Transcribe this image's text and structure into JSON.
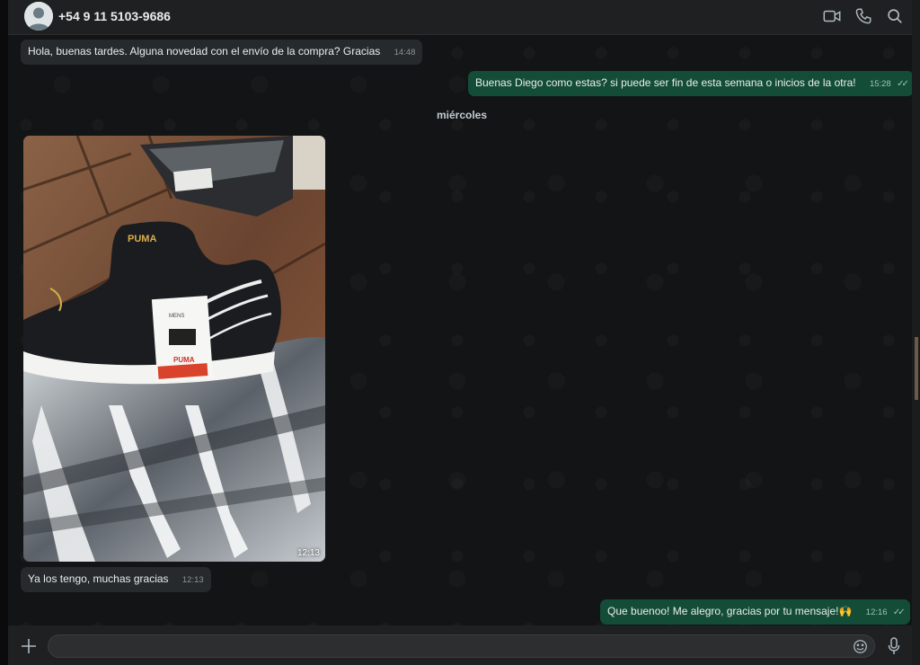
{
  "header": {
    "contact_name": "+54 9 11 5103-9686",
    "icons": [
      "avatar-icon",
      "video-call-icon",
      "voice-call-icon",
      "search-icon"
    ]
  },
  "messages": [
    {
      "direction": "in",
      "text": "Hola, buenas tardes. Alguna novedad con el envío de la compra? Gracias",
      "time": "14:48"
    },
    {
      "direction": "out",
      "text": "Buenas Diego como estas? si puede ser fin de esta semana o inicios de la otra!",
      "time": "15:28",
      "status": "read"
    },
    {
      "direction": "in",
      "type": "image",
      "time": "12:13"
    },
    {
      "direction": "in",
      "text": "Ya los tengo, muchas gracias",
      "time": "12:13"
    },
    {
      "direction": "out",
      "text": "Que buenoo! Me alegro, gracias por tu mensaje!🙌",
      "time": "12:16",
      "status": "read"
    }
  ],
  "day_separator": "miércoles",
  "photo": {
    "brand_text": "PUMA",
    "tag_text": "MENS"
  },
  "composer": {
    "value": "",
    "placeholder": "",
    "icons": [
      "plus-icon",
      "emoji-icon",
      "microphone-icon"
    ]
  },
  "colors": {
    "incoming_bubble": "#262a2c",
    "outgoing_bubble": "#144d37",
    "header_bg": "#1f2021",
    "chat_bg": "#121416"
  }
}
